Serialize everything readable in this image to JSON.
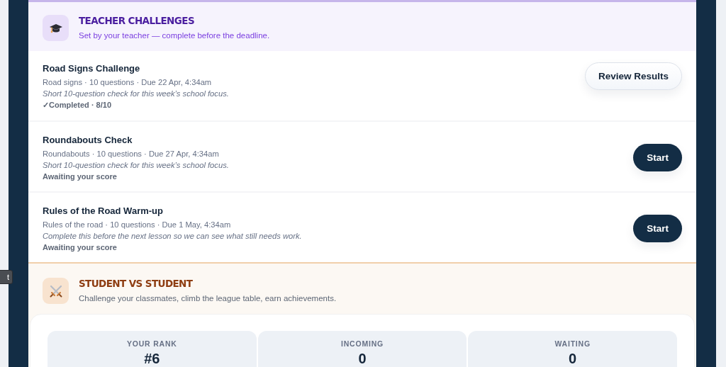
{
  "tooltip": {
    "text": "t"
  },
  "teacher_challenges": {
    "title": "TEACHER CHALLENGES",
    "subtitle": "Set by your teacher — complete before the deadline.",
    "items": [
      {
        "title": "Road Signs Challenge",
        "meta": "Road signs · 10 questions · Due 22 Apr, 4:34am",
        "description": "Short 10-question check for this week’s school focus.",
        "status": "✓Completed · 8/10",
        "action": {
          "kind": "review",
          "label": "Review Results"
        }
      },
      {
        "title": "Roundabouts Check",
        "meta": "Roundabouts · 10 questions · Due 27 Apr, 4:34am",
        "description": "Short 10-question check for this week’s school focus.",
        "status": "Awaiting your score",
        "action": {
          "kind": "start",
          "label": "Start"
        }
      },
      {
        "title": "Rules of the Road Warm-up",
        "meta": "Rules of the road · 10 questions · Due 1 May, 4:34am",
        "description": "Complete this before the next lesson so we can see what still needs work.",
        "status": "Awaiting your score",
        "action": {
          "kind": "start",
          "label": "Start"
        }
      }
    ]
  },
  "student_vs_student": {
    "title": "STUDENT VS STUDENT",
    "subtitle": "Challenge your classmates, climb the league table, earn achievements.",
    "stats": [
      {
        "label": "YOUR RANK",
        "value": "#6"
      },
      {
        "label": "INCOMING",
        "value": "0"
      },
      {
        "label": "WAITING",
        "value": "0"
      }
    ]
  }
}
